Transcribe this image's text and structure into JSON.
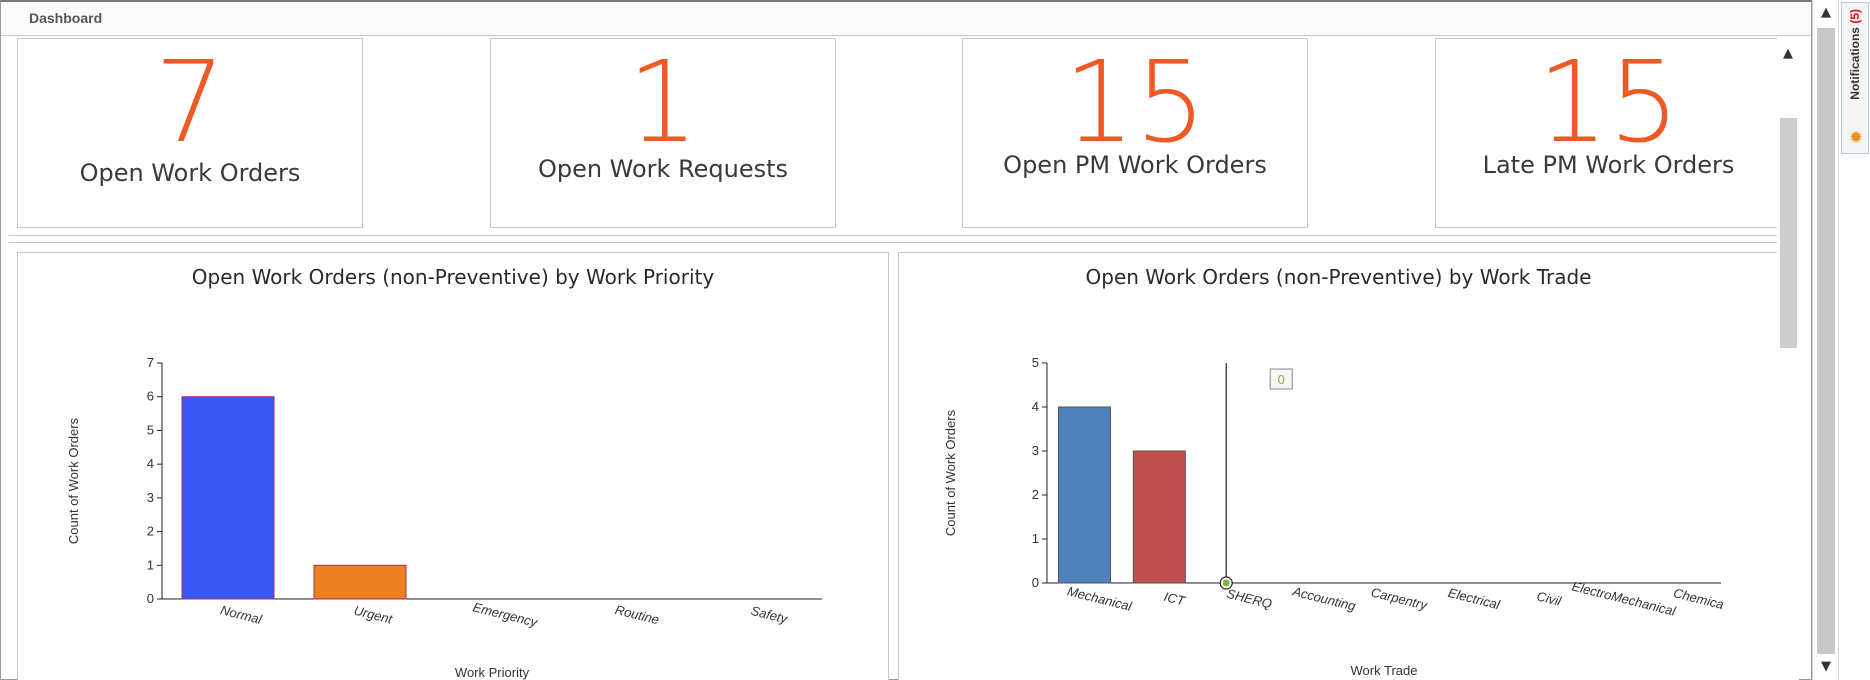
{
  "window": {
    "title": "Dashboard"
  },
  "notifications": {
    "label": "Notifications",
    "count": "(5)",
    "icon": "gear-alert-icon"
  },
  "scroll": {
    "up": "▲",
    "down": "▼"
  },
  "kpis": [
    {
      "value": "7",
      "label": "Open Work Orders"
    },
    {
      "value": "1",
      "label": "Open Work Requests"
    },
    {
      "value": "15",
      "label": "Open PM Work Orders"
    },
    {
      "value": "15",
      "label": "Late PM Work Orders"
    }
  ],
  "colors": {
    "kpi_value": "#ef5a24",
    "bar_blue": "#3a56f5",
    "bar_orange": "#ec8020",
    "bar_steel": "#4f81bd",
    "bar_red": "#c0504d"
  },
  "chart_data": [
    {
      "type": "bar",
      "title": "Open Work Orders (non-Preventive) by Work Priority",
      "xlabel": "Work Priority",
      "ylabel": "Count of Work Orders",
      "categories": [
        "Normal",
        "Urgent",
        "Emergency",
        "Routine",
        "Safety"
      ],
      "values": [
        6,
        1,
        0,
        0,
        0
      ],
      "bar_colors": [
        "#3a56f5",
        "#ec8020",
        "#3a56f5",
        "#3a56f5",
        "#3a56f5"
      ],
      "ylim": [
        0,
        7
      ],
      "yticks": [
        0,
        1,
        2,
        3,
        4,
        5,
        6,
        7
      ],
      "grid": false
    },
    {
      "type": "bar",
      "title": "Open Work Orders (non-Preventive) by Work Trade",
      "xlabel": "Work Trade",
      "ylabel": "Count of Work Orders",
      "categories": [
        "Mechanical",
        "ICT",
        "SHERQ",
        "Accounting",
        "Carpentry",
        "Electrical",
        "Civil",
        "ElectroMechanical",
        "Chemica"
      ],
      "values": [
        4,
        3,
        0,
        0,
        0,
        0,
        0,
        0,
        0
      ],
      "bar_colors": [
        "#4f81bd",
        "#c0504d",
        "#4f81bd",
        "#4f81bd",
        "#4f81bd",
        "#4f81bd",
        "#4f81bd",
        "#4f81bd",
        "#4f81bd"
      ],
      "ylim": [
        0,
        5
      ],
      "yticks": [
        0,
        1,
        2,
        3,
        4,
        5
      ],
      "grid": false,
      "hover_category": "SHERQ",
      "tooltip": "0"
    }
  ]
}
